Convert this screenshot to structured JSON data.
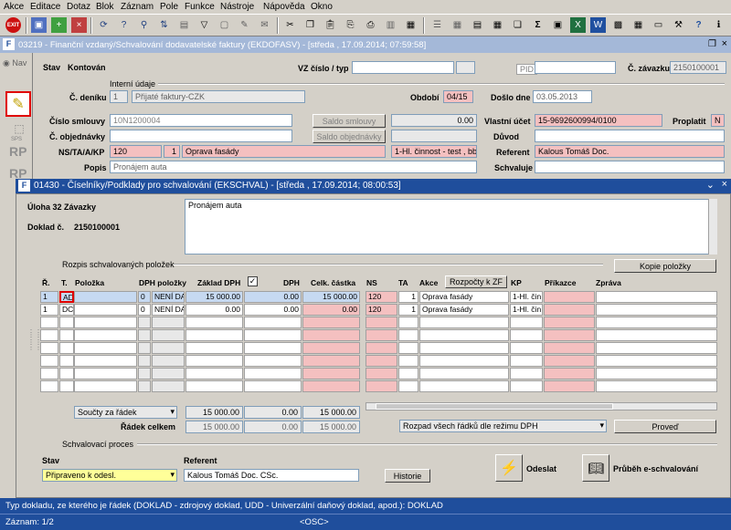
{
  "menu": [
    "Akce",
    "Editace",
    "Dotaz",
    "Blok",
    "Záznam",
    "Pole",
    "Funkce",
    "Nástroje",
    "Nápověda",
    "Okno"
  ],
  "toolbar_icons": [
    "exit-icon",
    "save-icon",
    "add-icon",
    "delete-icon",
    "refresh-icon",
    "query-icon",
    "filter-icon",
    "clear-icon",
    "mail-icon",
    "cut-icon",
    "copy-icon",
    "paste-icon",
    "attach-icon",
    "print-icon",
    "sum-icon",
    "excel-icon",
    "word-icon",
    "dup-icon",
    "calculator-icon",
    "help-icon",
    "info-icon"
  ],
  "win1": {
    "title": "03219 - Finanční vzdaný/Schvalování dodavatelské faktury (EKDOFASV) - [středa , 17.09.2014; 07:59:58]"
  },
  "nav": {
    "label": "Nav",
    "sps": "SPS",
    "rp1": "RP",
    "rp2": "RP"
  },
  "form1": {
    "stav_label": "Stav",
    "stav_value": "Kontován",
    "vz_label": "VZ číslo / typ",
    "vz_value": "",
    "pid_label": "PID",
    "pid_value": "",
    "zavazek_label": "Č. závazku",
    "zavazek_value": "2150100001",
    "interni": "Interní údaje",
    "denik_label": "Č. deníku",
    "denik_num": "1",
    "denik_name": "Přijaté faktury-CZK",
    "obdobi_label": "Období",
    "obdobi_value": "04/15",
    "doslo_label": "Došlo dne",
    "doslo_value": "03.05.2013",
    "smlouva_label": "Číslo smlouvy",
    "smlouva_value": "10N1200004",
    "saldo_smlouvy": "Saldo smlouvy",
    "saldo_value": "0.00",
    "ucet_label": "Vlastní účet",
    "ucet_value": "15-9692600994/0100",
    "proplat_label": "Proplatit",
    "proplat_value": "N",
    "objednavka_label": "Č. objednávky",
    "objednavka_value": "",
    "saldo_objednavky": "Saldo objednávky",
    "saldo_obj_value": "",
    "duvod_label": "Důvod",
    "duvod_value": "",
    "ns_label": "NS/TA/A/KP",
    "ns_value": "120",
    "ta_value": "1",
    "a_value": "Oprava fasády",
    "kp_value": "1-Hl. činnost - test , bbb",
    "referent_label": "Referent",
    "referent_value": "Kalous Tomáš Doc.",
    "popis_label": "Popis",
    "popis_value": "Pronájem auta",
    "schvaluje_label": "Schvaluje",
    "schvaluje_value": ""
  },
  "win2": {
    "title": "01430 - Číselníky/Podklady pro schvalování (EKSCHVAL) - [středa , 17.09.2014; 08:00:53]",
    "uloha": "Úloha 32 Závazky",
    "doklad_label": "Doklad č.",
    "doklad_value": "2150100001",
    "note": "Pronájem auta",
    "rozpis_title": "Rozpis schvalovaných položek",
    "kopie_btn": "Kopie položky",
    "rozpocty_btn": "Rozpočty k ZF",
    "headers": {
      "r": "Ř.",
      "t": "T.",
      "polozka": "Položka",
      "dph_pol": "DPH položky",
      "zaklad": "Základ DPH",
      "dph": "DPH",
      "celk": "Celk. částka",
      "ns": "NS",
      "ta": "TA",
      "akce": "Akce",
      "kp": "KP",
      "prikazce": "Příkazce",
      "zprava": "Zpráva"
    },
    "rows": [
      {
        "r": "1",
        "t": "AD",
        "polozka": "",
        "dph_kod": "0",
        "dph_pol": "NENÍ DA",
        "zaklad": "15 000.00",
        "dph": "0.00",
        "celk": "15 000.00",
        "ns": "120",
        "ta": "1",
        "akce": "Oprava fasády",
        "kp": "1-Hl. čin",
        "prikazce": "",
        "zprava": ""
      },
      {
        "r": "1",
        "t": "DC",
        "polozka": "",
        "dph_kod": "0",
        "dph_pol": "NENÍ DA",
        "zaklad": "0.00",
        "dph": "0.00",
        "celk": "0.00",
        "ns": "120",
        "ta": "1",
        "akce": "Oprava fasády",
        "kp": "1-Hl. čin",
        "prikazce": "",
        "zprava": ""
      }
    ],
    "soucty_select": "Součty za řádek",
    "sum_zaklad": "15 000.00",
    "sum_dph": "0.00",
    "sum_celk": "15 000.00",
    "radek_celkem_label": "Řádek celkem",
    "rc_zaklad": "15 000.00",
    "rc_dph": "0.00",
    "rc_celk": "15 000.00",
    "rozpad_select": "Rozpad všech řádků dle režimu DPH",
    "proved_btn": "Proveď",
    "proces_title": "Schvalovací proces",
    "stav_label": "Stav",
    "stav_value": "Připraveno k odesl.",
    "referent_label": "Referent",
    "referent_value": "Kalous Tomáš Doc. CSc.",
    "historie_btn": "Historie",
    "odeslat_btn": "Odeslat",
    "prubeh_btn": "Průběh e-schvalování"
  },
  "status": {
    "hint": "Typ dokladu, ze kterého je řádek (DOKLAD - zdrojový doklad, UDD - Univerzální daňový doklad, apod.): DOKLAD",
    "record": "Záznam: 1/2",
    "osc": "<OSC>"
  }
}
